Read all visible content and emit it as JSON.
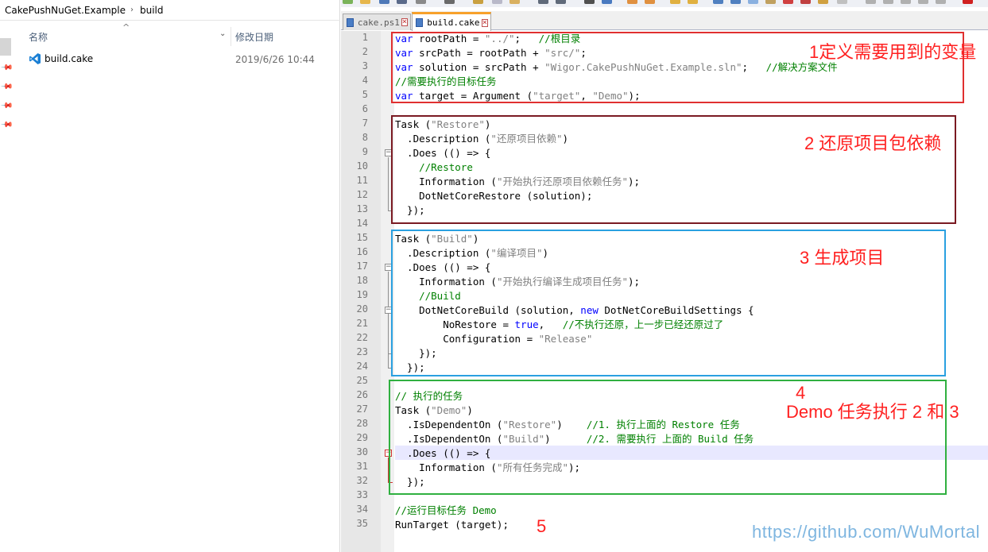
{
  "explorer": {
    "breadcrumb": [
      "CakePushNuGet.Example",
      "build"
    ],
    "columns": {
      "name": "名称",
      "modified": "修改日期"
    },
    "files": [
      {
        "name": "build.cake",
        "modified": "2019/6/26 10:44",
        "icon": "vscode-icon"
      }
    ]
  },
  "editor": {
    "tabs": [
      {
        "label": "cake.ps1",
        "active": false
      },
      {
        "label": "build.cake",
        "active": true
      }
    ],
    "line_numbers": [
      "1",
      "2",
      "3",
      "4",
      "5",
      "6",
      "7",
      "8",
      "9",
      "10",
      "11",
      "12",
      "13",
      "14",
      "15",
      "16",
      "17",
      "18",
      "19",
      "20",
      "21",
      "22",
      "23",
      "24",
      "25",
      "26",
      "27",
      "28",
      "29",
      "30",
      "31",
      "32",
      "33",
      "34",
      "35"
    ],
    "code_lines": [
      [
        [
          "kw",
          "var"
        ],
        [
          "p",
          " rootPath = "
        ],
        [
          "str",
          "\"../\""
        ],
        [
          "p",
          ";   "
        ],
        [
          "cm",
          "//根目录"
        ]
      ],
      [
        [
          "kw",
          "var"
        ],
        [
          "p",
          " srcPath = rootPath + "
        ],
        [
          "str",
          "\"src/\""
        ],
        [
          "p",
          ";"
        ]
      ],
      [
        [
          "kw",
          "var"
        ],
        [
          "p",
          " solution = srcPath + "
        ],
        [
          "str",
          "\"Wigor.CakePushNuGet.Example.sln\""
        ],
        [
          "p",
          ";   "
        ],
        [
          "cm",
          "//解决方案文件"
        ]
      ],
      [
        [
          "cm",
          "//需要执行的目标任务"
        ]
      ],
      [
        [
          "kw",
          "var"
        ],
        [
          "p",
          " target = Argument ("
        ],
        [
          "str",
          "\"target\""
        ],
        [
          "p",
          ", "
        ],
        [
          "str",
          "\"Demo\""
        ],
        [
          "p",
          ");"
        ]
      ],
      [],
      [
        [
          "p",
          "Task ("
        ],
        [
          "str",
          "\"Restore\""
        ],
        [
          "p",
          ")"
        ]
      ],
      [
        [
          "p",
          "  .Description ("
        ],
        [
          "str",
          "\"还原项目依赖\""
        ],
        [
          "p",
          ")"
        ]
      ],
      [
        [
          "p",
          "  .Does (() => {"
        ]
      ],
      [
        [
          "p",
          "    "
        ],
        [
          "cm",
          "//Restore"
        ]
      ],
      [
        [
          "p",
          "    Information ("
        ],
        [
          "str",
          "\"开始执行还原项目依赖任务\""
        ],
        [
          "p",
          ");"
        ]
      ],
      [
        [
          "p",
          "    DotNetCoreRestore (solution);"
        ]
      ],
      [
        [
          "p",
          "  });"
        ]
      ],
      [],
      [
        [
          "p",
          "Task ("
        ],
        [
          "str",
          "\"Build\""
        ],
        [
          "p",
          ")"
        ]
      ],
      [
        [
          "p",
          "  .Description ("
        ],
        [
          "str",
          "\"编译项目\""
        ],
        [
          "p",
          ")"
        ]
      ],
      [
        [
          "p",
          "  .Does (() => {"
        ]
      ],
      [
        [
          "p",
          "    Information ("
        ],
        [
          "str",
          "\"开始执行编译生成项目任务\""
        ],
        [
          "p",
          ");"
        ]
      ],
      [
        [
          "p",
          "    "
        ],
        [
          "cm",
          "//Build"
        ]
      ],
      [
        [
          "p",
          "    DotNetCoreBuild (solution, "
        ],
        [
          "kw",
          "new"
        ],
        [
          "p",
          " DotNetCoreBuildSettings {"
        ]
      ],
      [
        [
          "p",
          "        NoRestore = "
        ],
        [
          "kw",
          "true"
        ],
        [
          "p",
          ",   "
        ],
        [
          "cm",
          "//不执行还原，上一步已经还原过了"
        ]
      ],
      [
        [
          "p",
          "        Configuration = "
        ],
        [
          "str",
          "\"Release\""
        ]
      ],
      [
        [
          "p",
          "    });"
        ]
      ],
      [
        [
          "p",
          "  });"
        ]
      ],
      [],
      [
        [
          "cm",
          "// 执行的任务"
        ]
      ],
      [
        [
          "p",
          "Task ("
        ],
        [
          "str",
          "\"Demo\""
        ],
        [
          "p",
          ")"
        ]
      ],
      [
        [
          "p",
          "  .IsDependentOn ("
        ],
        [
          "str",
          "\"Restore\""
        ],
        [
          "p",
          ")    "
        ],
        [
          "cm",
          "//1. 执行上面的 Restore 任务"
        ]
      ],
      [
        [
          "p",
          "  .IsDependentOn ("
        ],
        [
          "str",
          "\"Build\""
        ],
        [
          "p",
          ")      "
        ],
        [
          "cm",
          "//2. 需要执行 上面的 Build 任务"
        ]
      ],
      [
        [
          "p",
          "  .Does (() => {"
        ]
      ],
      [
        [
          "p",
          "    Information ("
        ],
        [
          "str",
          "\"所有任务完成\""
        ],
        [
          "p",
          ");"
        ]
      ],
      [
        [
          "p",
          "  });"
        ]
      ],
      [],
      [
        [
          "cm",
          "//运行目标任务 Demo"
        ]
      ],
      [
        [
          "p",
          "RunTarget (target);"
        ]
      ]
    ]
  },
  "annotations": {
    "a1": "1定义需要用到的变量",
    "a2": "2 还原项目包依赖",
    "a3": "3  生成项目",
    "a4_num": "4",
    "a4_text": "Demo 任务执行 2 和 3",
    "a5": "5",
    "github": "https://github.com/WuMortal"
  },
  "colors": {
    "box1": "#e03030",
    "box2": "#7a1a22",
    "box3": "#2aa0e0",
    "box4": "#30b040",
    "keyword": "#0000ff",
    "string": "#808080",
    "comment": "#008000",
    "annotation": "#ff2020"
  }
}
